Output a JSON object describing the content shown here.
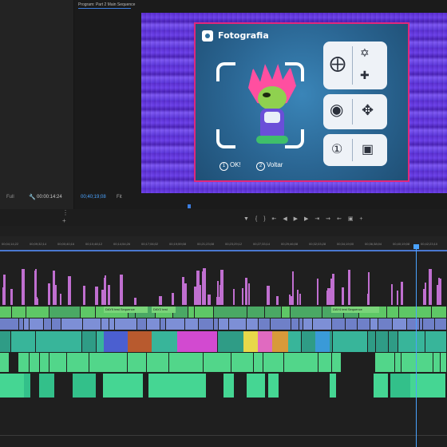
{
  "source_panel": {
    "zoom": "Full",
    "timecode": "00:00:14:24"
  },
  "program_panel": {
    "title": "Program: Part 2 Main Sequence",
    "timecode": "00;40;19;08",
    "fit": "Fit"
  },
  "video": {
    "game_title": "Fotografia",
    "ok_number": "1",
    "ok_label": "OK!",
    "voltar_number": "2",
    "voltar_label": "Voltar",
    "bg_color": "#6a3fe8",
    "border_color": "#e0287c"
  },
  "transport": {
    "icons": [
      "marker-icon",
      "in-point-icon",
      "out-point-icon",
      "go-to-in-icon",
      "step-back-icon",
      "play-icon",
      "step-forward-icon",
      "go-to-out-icon",
      "insert-icon",
      "overwrite-icon",
      "export-frame-icon",
      "button-editor-icon"
    ]
  },
  "timeline": {
    "ruler_timecodes": [
      "00;04;14;22",
      "00;09;32;14",
      "00;00;40;16",
      "00;10;48;12",
      "00;14;54;26",
      "00;17;06;02",
      "00;19;59;08",
      "00;21;23;08",
      "00;23;29;12",
      "00;27;33;14",
      "00;29;46;08",
      "00;32;03;28",
      "00;34;19;00",
      "00;36;38;04",
      "00;40;19;08",
      "00;42;23;10"
    ],
    "clip_labels": [
      "DAY5 test Sequence",
      "DAY2 test",
      "DAY4 test Sequence"
    ],
    "colors": {
      "video_top": "#c06fd0",
      "video_green": "#5ec766",
      "audio_blue": "#7d8fd6",
      "audio_teal": "#38b59a",
      "audio_green": "#52d68a"
    }
  }
}
